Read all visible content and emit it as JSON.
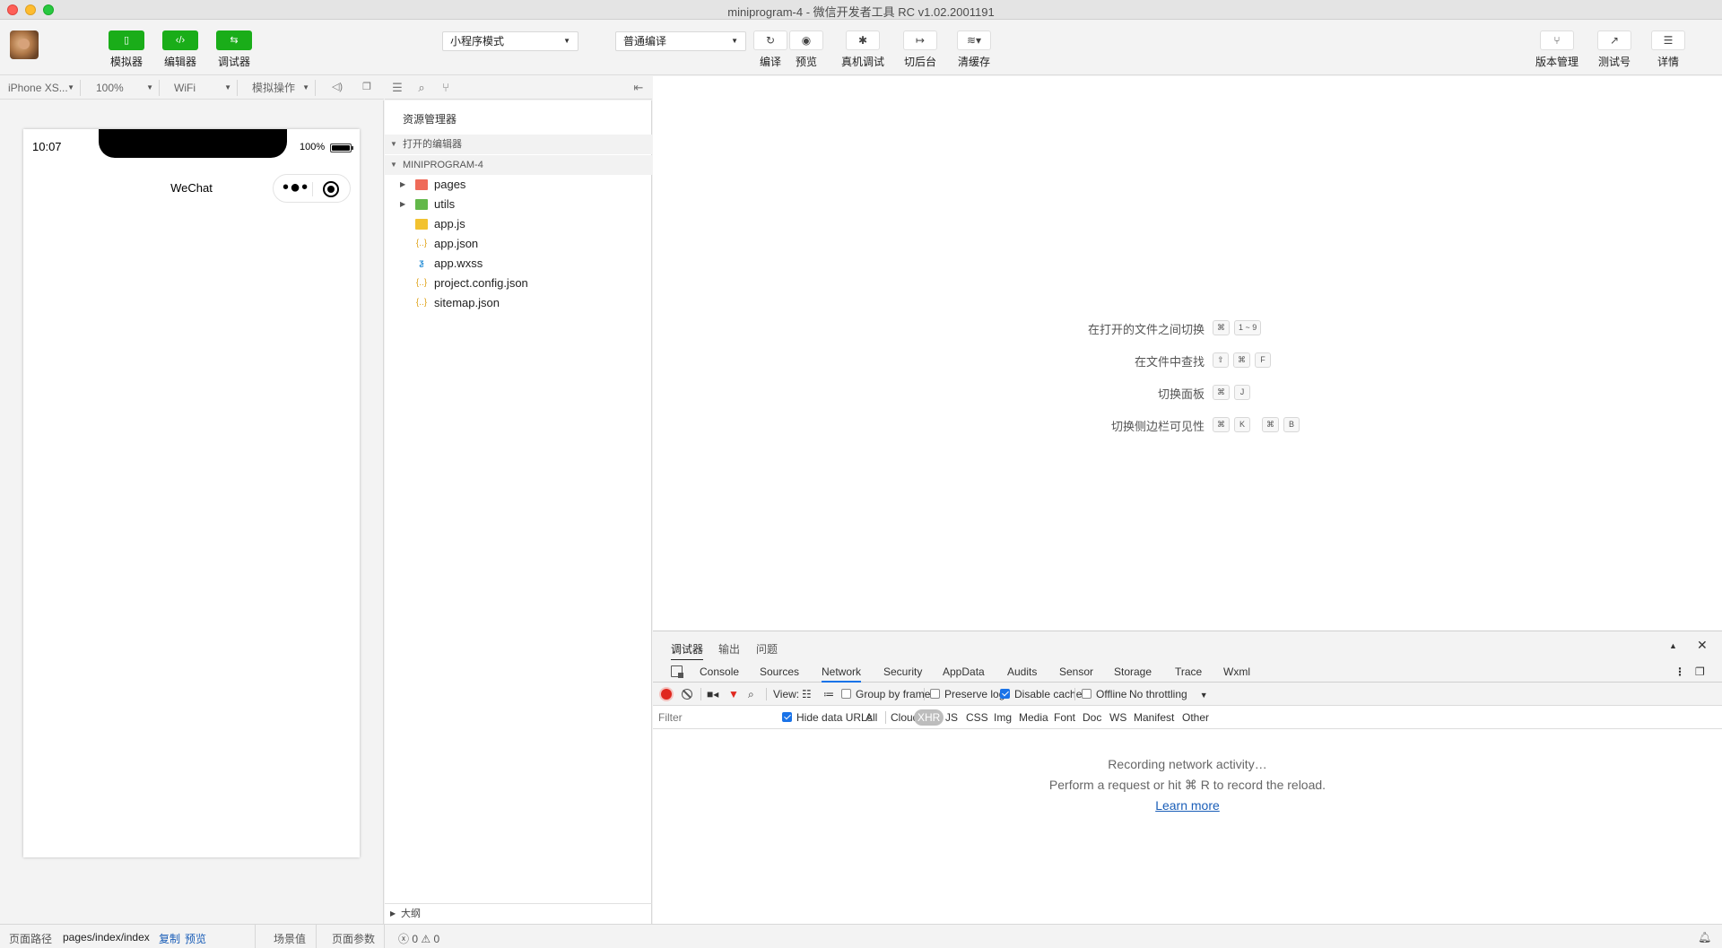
{
  "window": {
    "title": "miniprogram-4 - 微信开发者工具 RC v1.02.2001191"
  },
  "toolbar": {
    "simulator": "模拟器",
    "editor": "编辑器",
    "debugger": "调试器",
    "mode_select": "小程序模式",
    "compile_select": "普通编译",
    "compile": "编译",
    "preview": "预览",
    "real_debug": "真机调试",
    "background": "切后台",
    "clear_cache": "清缓存",
    "version_mgmt": "版本管理",
    "test_account": "测试号",
    "details": "详情"
  },
  "simbar": {
    "device": "iPhone XS...",
    "zoom": "100%",
    "network": "WiFi",
    "operation": "模拟操作"
  },
  "phone": {
    "time": "10:07",
    "battery": "100%",
    "nav_title": "WeChat"
  },
  "explorer": {
    "title": "资源管理器",
    "open_editors": "打开的编辑器",
    "project": "MINIPROGRAM-4",
    "files": [
      "pages",
      "utils",
      "app.js",
      "app.json",
      "app.wxss",
      "project.config.json",
      "sitemap.json"
    ],
    "outline": "大纲"
  },
  "shortcuts": [
    {
      "label": "在打开的文件之间切换",
      "keys": [
        "⌘",
        "1 ~ 9"
      ]
    },
    {
      "label": "在文件中查找",
      "keys": [
        "⇧",
        "⌘",
        "F"
      ]
    },
    {
      "label": "切换面板",
      "keys": [
        "⌘",
        "J"
      ]
    },
    {
      "label": "切换侧边栏可见性",
      "keys": [
        "⌘",
        "K",
        "⌘",
        "B"
      ]
    }
  ],
  "debug": {
    "tabs": [
      "调试器",
      "输出",
      "问题"
    ],
    "devtools": [
      "Console",
      "Sources",
      "Network",
      "Security",
      "AppData",
      "Audits",
      "Sensor",
      "Storage",
      "Trace",
      "Wxml"
    ],
    "view_label": "View:",
    "group_by_frame": "Group by frame",
    "preserve_log": "Preserve log",
    "disable_cache": "Disable cache",
    "offline": "Offline",
    "throttling": "No throttling",
    "filter_placeholder": "Filter",
    "hide_data_urls": "Hide data URLs",
    "filters": [
      "All",
      "Cloud",
      "XHR",
      "JS",
      "CSS",
      "Img",
      "Media",
      "Font",
      "Doc",
      "WS",
      "Manifest",
      "Other"
    ],
    "recording": "Recording network activity…",
    "hint": "Perform a request or hit ⌘ R to record the reload.",
    "learn_more": "Learn more"
  },
  "statusbar": {
    "page_path_label": "页面路径",
    "page_path": "pages/index/index",
    "copy": "复制",
    "preview": "预览",
    "scene": "场景值",
    "params": "页面参数",
    "errors": "0",
    "warnings": "0"
  }
}
